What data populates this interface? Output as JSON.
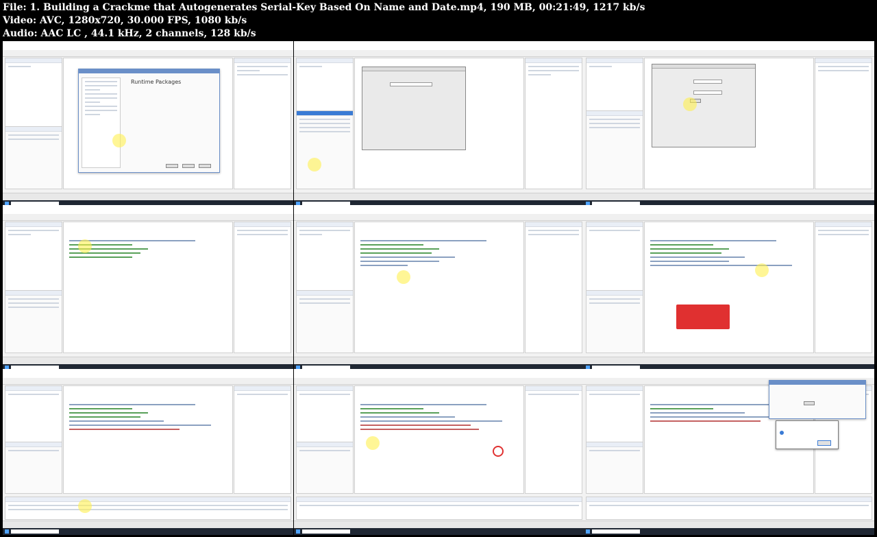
{
  "header": {
    "file_line": "File: 1. Building a Crackme that Autogenerates Serial-Key Based On Name and Date.mp4, 190 MB, 00:21:49, 1217 kb/s",
    "video_line": "Video: AVC, 1280x720, 30.000 FPS, 1080 kb/s",
    "audio_line": "Audio: AAC LC , 44.1 kHz, 2 channels, 128 kb/s"
  },
  "thumbnails": [
    {
      "id": 1,
      "scene": "project-options",
      "dialog_title": "Runtime Packages"
    },
    {
      "id": 2,
      "scene": "form-designer"
    },
    {
      "id": 3,
      "scene": "form-with-fields"
    },
    {
      "id": 4,
      "scene": "code-editor"
    },
    {
      "id": 5,
      "scene": "code-editor"
    },
    {
      "id": 6,
      "scene": "code-callout"
    },
    {
      "id": 7,
      "scene": "code-editor-messages"
    },
    {
      "id": 8,
      "scene": "code-editor-red-circle"
    },
    {
      "id": 9,
      "scene": "running-crackme-messagebox"
    }
  ],
  "colors": {
    "background": "#000000",
    "header_text": "#ffffff",
    "accent_blue": "#6a8fc8",
    "callout_red": "#e03030"
  }
}
